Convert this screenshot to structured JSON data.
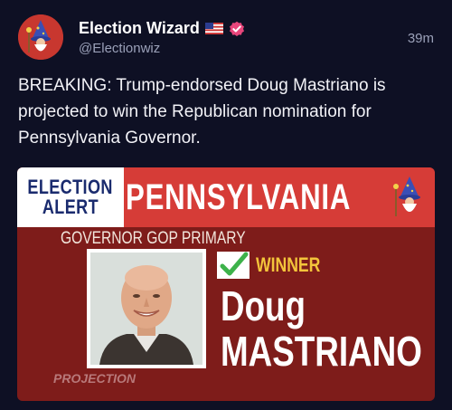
{
  "author": {
    "display_name": "Election Wizard",
    "handle": "@Electionwiz",
    "flag_icon": "us-flag-icon",
    "verified_icon": "verified-badge-icon",
    "verified_color": "#e8467c"
  },
  "timestamp": "39m",
  "tweet": {
    "text": "BREAKING: Trump-endorsed Doug Mastriano is projected to win the Republican nomination for Pennsylvania Governor."
  },
  "card": {
    "alert_line1": "ELECTION",
    "alert_line2": "ALERT",
    "state": "PENNSYLVANIA",
    "race": "GOVERNOR GOP PRIMARY",
    "winner_label": "WINNER",
    "candidate_first": "Doug",
    "candidate_last": "MASTRIANO",
    "projection": "PROJECTION",
    "colors": {
      "header_red": "#d63c37",
      "card_maroon": "#7e1c1a",
      "alert_navy": "#1a2b6e",
      "winner_gold": "#f3c43b",
      "check_green": "#3db24a"
    }
  }
}
